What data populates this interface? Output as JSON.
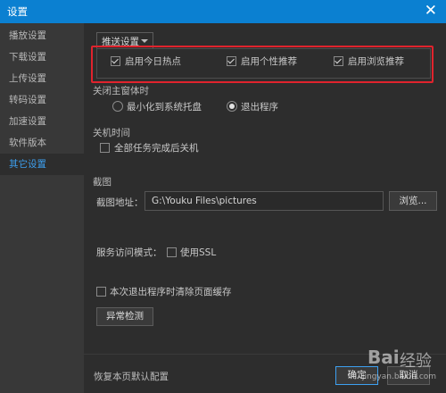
{
  "window": {
    "title": "设置",
    "close_glyph": "✕"
  },
  "sidebar": {
    "items": [
      {
        "label": "播放设置",
        "active": false
      },
      {
        "label": "下载设置",
        "active": false
      },
      {
        "label": "上传设置",
        "active": false
      },
      {
        "label": "转码设置",
        "active": false
      },
      {
        "label": "加速设置",
        "active": false
      },
      {
        "label": "软件版本",
        "active": false
      },
      {
        "label": "其它设置",
        "active": true
      }
    ]
  },
  "push": {
    "dropdown_label": "推送设置",
    "options": [
      {
        "label": "启用今日热点",
        "checked": true
      },
      {
        "label": "启用个性推荐",
        "checked": true
      },
      {
        "label": "启用浏览推荐",
        "checked": true
      }
    ],
    "highlight_color": "#e0232d"
  },
  "close_main": {
    "heading": "关闭主窗体时",
    "options": [
      {
        "label": "最小化到系统托盘",
        "selected": false
      },
      {
        "label": "退出程序",
        "selected": true
      }
    ]
  },
  "shutdown": {
    "heading": "关机时间",
    "option": {
      "label": "全部任务完成后关机",
      "checked": false
    }
  },
  "screenshot": {
    "heading": "截图",
    "path_label": "截图地址：",
    "path_value": "G:\\Youku Files\\pictures",
    "browse_label": "浏览..."
  },
  "service": {
    "label": "服务访问模式：",
    "ssl_label": "使用SSL",
    "ssl_checked": false
  },
  "cache": {
    "label": "本次退出程序时清除页面缓存",
    "checked": false
  },
  "diagnose_label": "异常检测",
  "footer": {
    "restore_label": "恢复本页默认配置",
    "confirm_label": "确定",
    "cancel_label": "取消"
  },
  "watermark": {
    "logo": "Bai",
    "text": "经验",
    "url": "jingyan.baidu.com"
  },
  "colors": {
    "accent": "#0b80d1",
    "active_text": "#3da0f0",
    "background": "#2d2d2d",
    "sidebar": "#383838"
  }
}
